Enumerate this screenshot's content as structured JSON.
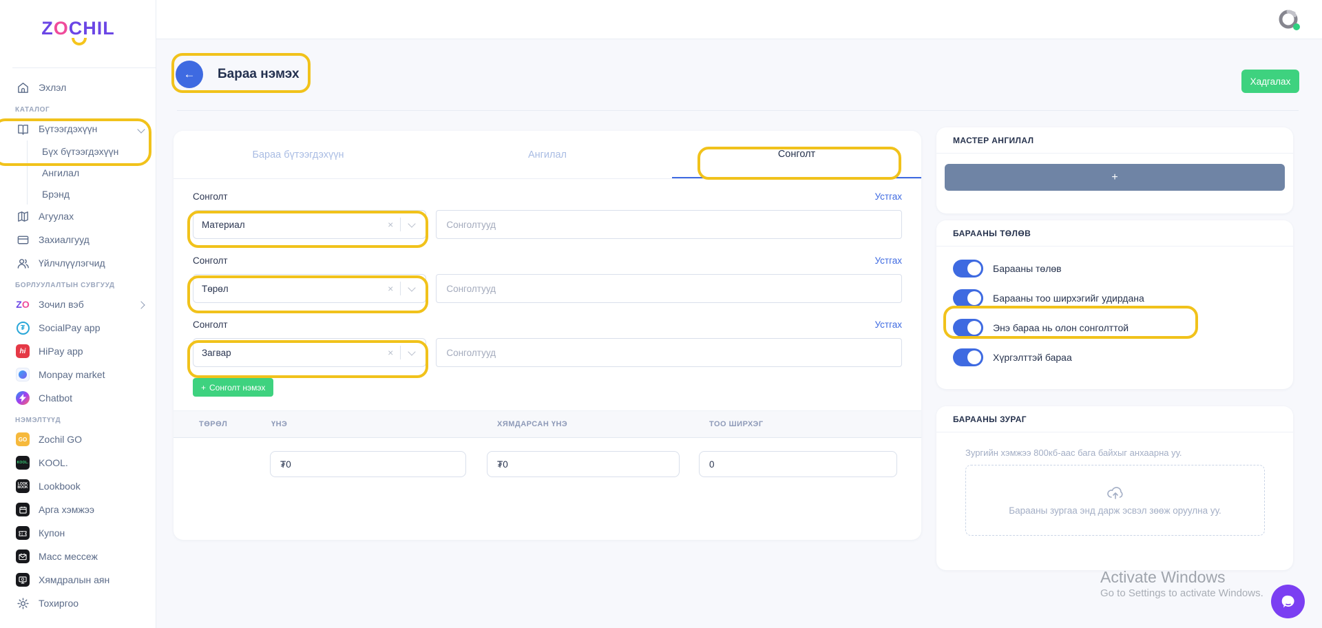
{
  "brand": {
    "logo_part1": "Z",
    "logo_part2": "O",
    "logo_part3": "CHIL"
  },
  "colors": {
    "accent_blue": "#3e6ae1",
    "green": "#3ed27f",
    "annotation_gold": "#f1c21b",
    "slate_button": "#6f84a5",
    "chat_purple": "#7b3ff2",
    "logo_purple": "#6b46e5",
    "logo_pink": "#ef4b9b",
    "logo_yellow": "#f5c51c",
    "status_dot_green": "#2fd180"
  },
  "sidebar": {
    "entries": [
      {
        "type": "item",
        "icon": "home-icon",
        "label": "Эхлэл"
      },
      {
        "type": "section",
        "label": "КАТАЛОГ"
      },
      {
        "type": "item",
        "icon": "book-icon",
        "label": "Бүтээгдэхүүн",
        "chevron": "down"
      },
      {
        "type": "subitem",
        "label": "Бүх бүтээгдэхүүн"
      },
      {
        "type": "subitem",
        "label": "Ангилал"
      },
      {
        "type": "subitem",
        "label": "Брэнд"
      },
      {
        "type": "item",
        "icon": "map-icon",
        "label": "Агуулах"
      },
      {
        "type": "item",
        "icon": "card-icon",
        "label": "Захиалгууд"
      },
      {
        "type": "item",
        "icon": "users-icon",
        "label": "Үйлчлүүлэгчид"
      },
      {
        "type": "section",
        "label": "БОРЛУУЛАЛТЫН СУВГУУД"
      },
      {
        "type": "item",
        "icon": "zochil-web-icon",
        "label": "Зочил вэб",
        "chevron": "right"
      },
      {
        "type": "item",
        "icon": "socialpay-icon",
        "label": "SocialPay app"
      },
      {
        "type": "item",
        "icon": "hipay-icon",
        "label": "HiPay app"
      },
      {
        "type": "item",
        "icon": "monpay-icon",
        "label": "Monpay market"
      },
      {
        "type": "item",
        "icon": "chatbot-icon",
        "label": "Chatbot"
      },
      {
        "type": "section",
        "label": "НЭМЭЛТҮҮД"
      },
      {
        "type": "item",
        "icon": "zochil-go-icon",
        "label": "Zochil GO"
      },
      {
        "type": "item",
        "icon": "kool-icon",
        "label": "KOOL."
      },
      {
        "type": "item",
        "icon": "lookbook-icon",
        "label": "Lookbook"
      },
      {
        "type": "item",
        "icon": "event-icon",
        "label": "Арга хэмжээ"
      },
      {
        "type": "item",
        "icon": "coupon-icon",
        "label": "Купон"
      },
      {
        "type": "item",
        "icon": "mass-message-icon",
        "label": "Масс мессеж"
      },
      {
        "type": "item",
        "icon": "sale-campaign-icon",
        "label": "Хямдралын аян"
      },
      {
        "type": "item",
        "icon": "gear-icon",
        "label": "Тохиргоо"
      }
    ]
  },
  "page": {
    "title": "Бараа нэмэх",
    "save_label": "Хадгалах"
  },
  "tabs": [
    {
      "label": "Бараа бүтээгдэхүүн",
      "active": false
    },
    {
      "label": "Ангилал",
      "active": false
    },
    {
      "label": "Сонголт",
      "active": true
    }
  ],
  "options": {
    "row_label": "Сонголт",
    "delete_label": "Устгах",
    "input_placeholder": "Сонголтууд",
    "rows": [
      {
        "value": "Материал"
      },
      {
        "value": "Төрөл"
      },
      {
        "value": "Загвар"
      }
    ],
    "add_button_label": "Сонголт нэмэх",
    "add_button_plus": "+"
  },
  "variants_table": {
    "headers": [
      "ТӨРӨЛ",
      "ҮНЭ",
      "ХЯМДАРСАН ҮНЭ",
      "ТОО ШИРХЭГ"
    ],
    "row": {
      "price": "₮0",
      "sale_price": "₮0",
      "quantity": "0"
    }
  },
  "master_category": {
    "title": "МАСТЕР АНГИЛАЛ",
    "add_label": "+"
  },
  "product_status": {
    "title": "БАРААНЫ ТӨЛӨВ",
    "toggles": [
      {
        "label": "Барааны төлөв",
        "on": true
      },
      {
        "label": "Барааны тоо ширхэгийг удирдана",
        "on": true
      },
      {
        "label": "Энэ бараа нь олон сонголттой",
        "on": true,
        "highlighted": true
      },
      {
        "label": "Хүргэлттэй бараа",
        "on": true
      }
    ]
  },
  "product_image": {
    "title": "БАРААНЫ ЗУРАГ",
    "hint": "Зургийн хэмжээ 800кб-аас бага байхыг анхаарна уу.",
    "dropzone_text": "Барааны зургаа энд дарж эсвэл зөөж оруулна уу."
  },
  "watermark": {
    "line1": "Activate Windows",
    "line2": "Go to Settings to activate Windows."
  }
}
